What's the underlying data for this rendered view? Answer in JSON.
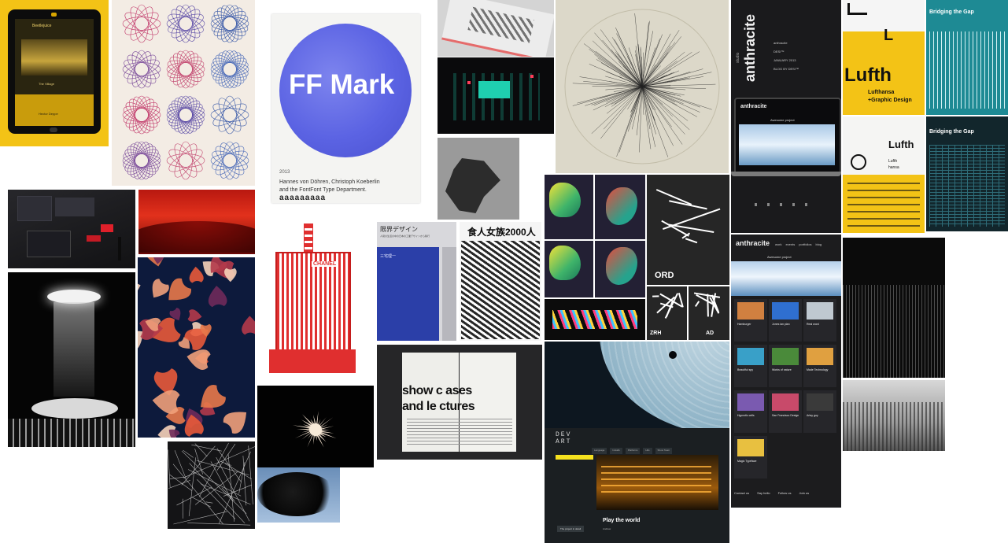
{
  "colors": {
    "page_bg": "#ffffff",
    "yellow": "#f3c316",
    "teal": "#1e8a94",
    "ff_blue": "#5b63e3",
    "chinese_red": "#e02f2f",
    "japan_blue": "#2b3fa8",
    "dark": "#1e1e20"
  },
  "ipad": {
    "title": "Beetlejuice",
    "subtitle": "The Village",
    "caption": "Hector Deppe"
  },
  "ff_mark": {
    "title": "FF Mark",
    "year": "2013",
    "credit_line1": "Hannes von Döhren, Christoph Koeberlin",
    "credit_line2": "and the FontFont Type Department.",
    "glyphs": "aaaaaaaaa"
  },
  "anthracite": {
    "brand": "anthracite",
    "prefix": "studio",
    "project": "Awesome project",
    "meta": [
      "anthracite",
      "DESI™",
      "JANUARY 2013",
      "BLOG BY DESI™"
    ],
    "nav": [
      "work",
      "events",
      "portfolios",
      "blog"
    ],
    "cards": [
      "Hamburger",
      "Jones lan plan",
      "Real word",
      "Beautiful spy",
      "Works of nature",
      "Made Technology",
      "Hypnotic cells",
      "San Francisco Design",
      "Artsy guy",
      "Magic Typeface"
    ],
    "footer": [
      "Contact us",
      "Say hello",
      "Follow us",
      "Join us"
    ]
  },
  "lufthansa": {
    "word": "Lufth",
    "letter": "L",
    "caption_line1": "Lufthansa",
    "caption_line2": "+Graphic Design",
    "small_words": [
      "Lufth",
      "Lufth",
      "hansa"
    ]
  },
  "bridging": {
    "title1": "Bridging the Gap",
    "title2": "Bridging the Gap"
  },
  "japan": {
    "title": "限界デザイン",
    "subtitle": "人間の生活の中の日本の工業デザインから移行",
    "author": "三宅理一"
  },
  "china": {
    "title": "食人女族2000人"
  },
  "chanel": {
    "label": "CHANEL"
  },
  "magazine": {
    "line1": "show c   ases",
    "line2": "and le   ctures"
  },
  "airports": [
    "ORD",
    "ZRH",
    "AD"
  ],
  "devart": {
    "logo_line1": "DEV",
    "logo_line2": "ART",
    "heading": "Play the world",
    "sub": "Andrew",
    "cta": "The project in detail",
    "tabs": [
      "Language",
      "Installs",
      "Platforms",
      "Hits",
      "Show Team"
    ]
  }
}
